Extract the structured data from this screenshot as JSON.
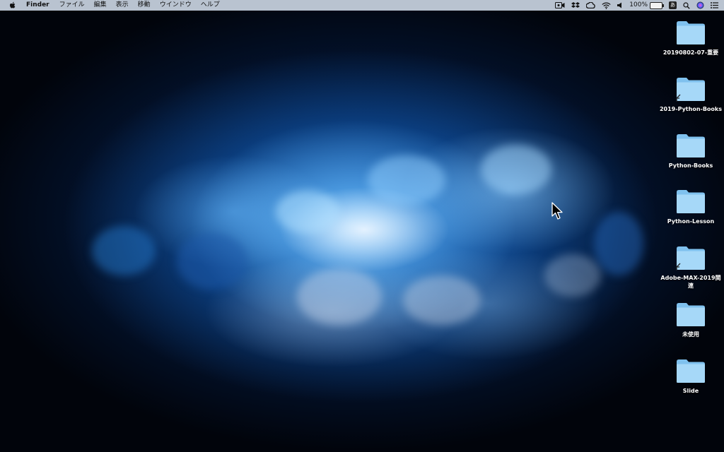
{
  "menubar": {
    "app_name": "Finder",
    "items": [
      "ファイル",
      "編集",
      "表示",
      "移動",
      "ウインドウ",
      "ヘルプ"
    ],
    "battery_percent": "100%",
    "ime": "あ"
  },
  "desktop_icons": [
    {
      "label": "20190802-07-重要",
      "alias": false
    },
    {
      "label": "2019-Python-Books",
      "alias": true
    },
    {
      "label": "Python-Books",
      "alias": false
    },
    {
      "label": "Python-Lesson",
      "alias": false
    },
    {
      "label": "Adobe-MAX-2019関連",
      "alias": true
    },
    {
      "label": "未使用",
      "alias": false
    },
    {
      "label": "Slide",
      "alias": false
    }
  ],
  "colors": {
    "menubar_bg": "#b9c3d0",
    "folder_front": "#9fd5f7",
    "folder_back": "#7fc1ee"
  }
}
